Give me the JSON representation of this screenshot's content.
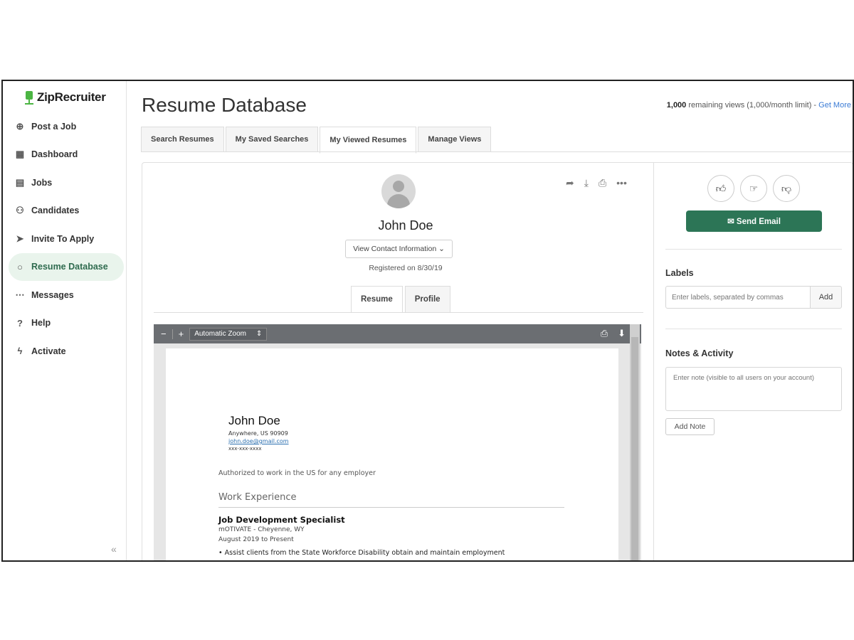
{
  "brand": {
    "name": "ZipRecruiter",
    "accent": "#4bb543",
    "primary_button": "#2c7556"
  },
  "sidebar": {
    "items": [
      {
        "label": "Post a Job",
        "icon": "plus-circle-icon",
        "glyph": "⊕"
      },
      {
        "label": "Dashboard",
        "icon": "dashboard-grid-icon",
        "glyph": "▦"
      },
      {
        "label": "Jobs",
        "icon": "document-icon",
        "glyph": "▤"
      },
      {
        "label": "Candidates",
        "icon": "people-icon",
        "glyph": "⚇"
      },
      {
        "label": "Invite To Apply",
        "icon": "paper-plane-icon",
        "glyph": "➤"
      },
      {
        "label": "Resume Database",
        "icon": "search-icon",
        "glyph": "○"
      },
      {
        "label": "Messages",
        "icon": "chat-bubble-icon",
        "glyph": "⋯"
      },
      {
        "label": "Help",
        "icon": "question-circle-icon",
        "glyph": "?"
      },
      {
        "label": "Activate",
        "icon": "lightning-circle-icon",
        "glyph": "ϟ"
      }
    ],
    "active_item": "Resume Database",
    "collapse_glyph": "«"
  },
  "header": {
    "title": "Resume Database",
    "views_count": "1,000",
    "views_text": " remaining views (1,000/month limit) - ",
    "views_link": "Get More"
  },
  "tabs": [
    {
      "label": "Search Resumes"
    },
    {
      "label": "My Saved Searches"
    },
    {
      "label": "My Viewed Resumes"
    },
    {
      "label": "Manage Views"
    }
  ],
  "active_tab": "My Viewed Resumes",
  "candidate": {
    "name": "John Doe",
    "contact_button": "View Contact Information ⌄",
    "registered": "Registered on 8/30/19",
    "subtabs": [
      {
        "label": "Resume"
      },
      {
        "label": "Profile"
      }
    ],
    "actions": [
      "share-icon",
      "download-icon",
      "print-icon",
      "more-icon"
    ]
  },
  "pdf_viewer": {
    "zoom": "Automatic Zoom",
    "resume": {
      "name": "John Doe",
      "address": "Anywhere, US 90909",
      "email": "john.doe@gmail.com",
      "phone": "xxx-xxx-xxxx",
      "authorization": "Authorized to work in the US for any employer",
      "section": "Work Experience",
      "job_title": "Job Development Specialist",
      "company": "mOTIVATE - Cheyenne, WY",
      "dates": "August 2019 to Present",
      "bullet": "• Assist clients from the State Workforce Disability obtain and maintain employment"
    }
  },
  "side_panel": {
    "send_email": "✉ Send Email",
    "labels_title": "Labels",
    "labels_placeholder": "Enter labels, separated by commas",
    "labels_add": "Add",
    "notes_title": "Notes & Activity",
    "notes_placeholder": "Enter note (visible to all users on your account)",
    "add_note": "Add Note"
  }
}
